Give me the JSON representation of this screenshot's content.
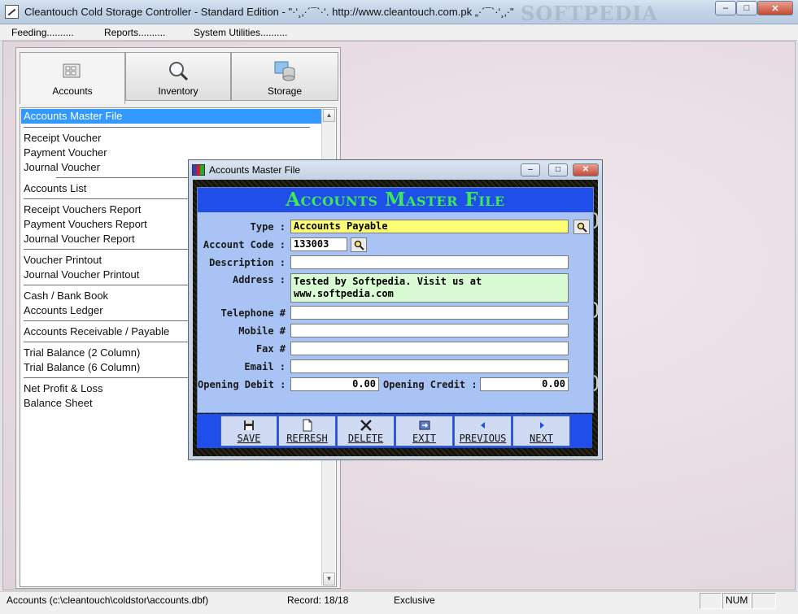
{
  "window": {
    "title": "Cleantouch Cold Storage Controller - Standard Edition  -  \"·‘¸‚·´¯`·‘. http://www.cleantouch.com.pk „·´¯`·‘¸‚·\"",
    "watermark": "SOFTPEDIA",
    "controls": {
      "minimize": "–",
      "maximize": "□",
      "close": "✕"
    }
  },
  "menu": [
    "Feeding..........",
    "Reports..........",
    "System Utilities.........."
  ],
  "tabs": [
    {
      "label": "Accounts",
      "icon": "calculator-icon"
    },
    {
      "label": "Inventory",
      "icon": "magnifier-icon"
    },
    {
      "label": "Storage",
      "icon": "database-icon"
    }
  ],
  "list": {
    "selected": "Accounts Master File",
    "items": [
      "Receipt Voucher",
      "Payment Voucher",
      "Journal Voucher",
      "Accounts List",
      "Receipt Vouchers Report",
      "Payment Vouchers Report",
      "Journal Voucher Report",
      "Voucher Printout",
      "Journal Voucher Printout",
      "Cash / Bank Book",
      "Accounts Ledger",
      "Accounts Receivable / Payable",
      "Trial Balance (2 Column)",
      "Trial Balance (6 Column)",
      "Net Profit & Loss",
      "Balance Sheet"
    ]
  },
  "dialog": {
    "title": "Accounts Master File",
    "header": "Accounts Master File",
    "labels": {
      "type": "Type :",
      "account_code": "Account Code :",
      "description": "Description :",
      "address": "Address :",
      "telephone": "Telephone #",
      "mobile": "Mobile #",
      "fax": "Fax #",
      "email": "Email :",
      "opening_debit": "Opening Debit :",
      "opening_credit": "Opening Credit :"
    },
    "values": {
      "type": "Accounts Payable",
      "account_code": "133003",
      "description": "",
      "address": "Tested by Softpedia. Visit us at www.softpedia.com",
      "telephone": "",
      "mobile": "",
      "fax": "",
      "email": "",
      "opening_debit": "0.00",
      "opening_credit": "0.00"
    },
    "buttons": {
      "save": "SAVE",
      "refresh": "REFRESH",
      "delete": "DELETE",
      "exit": "EXIT",
      "previous": "PREVIOUS",
      "next": "NEXT"
    }
  },
  "status": {
    "file": "Accounts (c:\\cleantouch\\coldstor\\accounts.dbf)",
    "record": "Record: 18/18",
    "mode": "Exclusive",
    "num": "NUM"
  },
  "colors": {
    "header_blue": "#1f4fe8",
    "header_text_green": "#3dea55",
    "form_background": "#a9c4f4",
    "selection_blue": "#3399ff",
    "type_field_yellow": "#fefe74",
    "address_field_green": "#d8fbd4"
  }
}
